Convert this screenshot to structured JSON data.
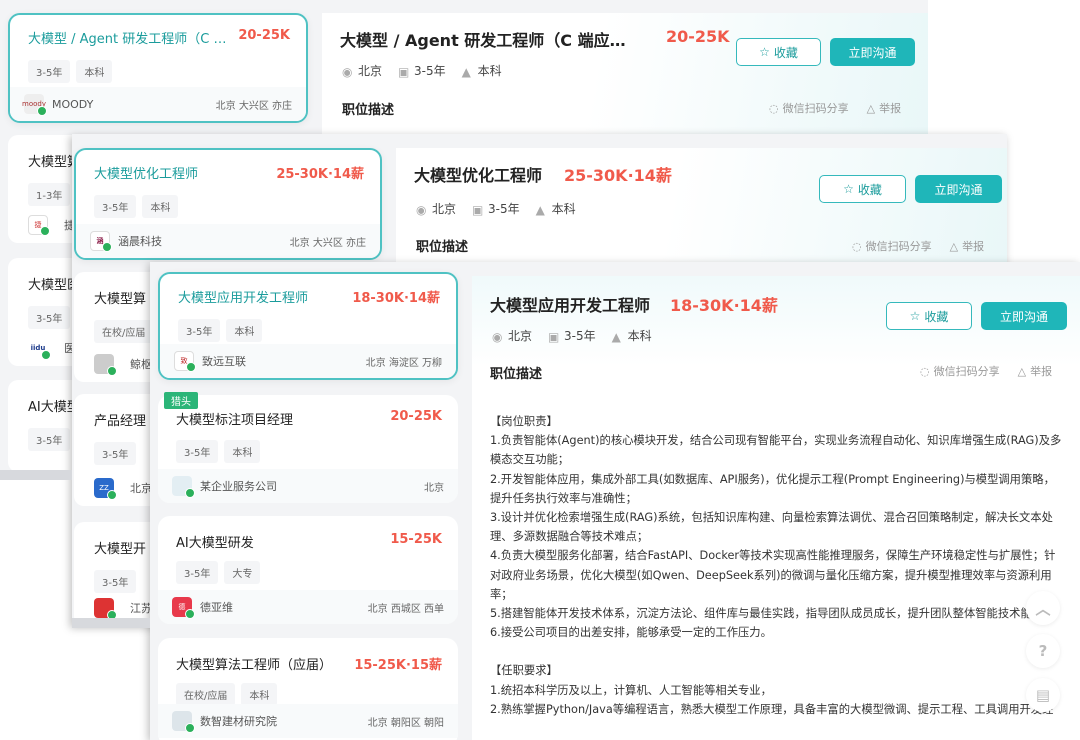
{
  "win1": {
    "card_active": {
      "title": "大模型 / Agent 研发工程师（C 端应用方向）",
      "salary": "20-25K",
      "tags": [
        "3-5年",
        "本科"
      ],
      "company": "MOODY",
      "location": "北京 大兴区 亦庄",
      "logo_text": "moody"
    },
    "frag_cards": [
      {
        "title": "大模型算",
        "tag": "1-3年",
        "company": "捷科",
        "logo_text": "捷"
      },
      {
        "title": "大模型医",
        "tag": "3-5年",
        "company": "医",
        "logo_text": "iidu"
      },
      {
        "title": "AI大模型",
        "tag": "3-5年",
        "company": "",
        "logo_text": ""
      }
    ],
    "detail": {
      "title": "大模型 / Agent 研发工程师（C 端应用方向）",
      "salary": "20-25K",
      "fav_label": "收藏",
      "chat_label": "立即沟通",
      "meta": [
        "北京",
        "3-5年",
        "本科"
      ],
      "section": "职位描述",
      "share": "微信扫码分享",
      "report": "举报"
    }
  },
  "win2": {
    "card_active": {
      "title": "大模型优化工程师",
      "salary": "25-30K·14薪",
      "tags": [
        "3-5年",
        "本科"
      ],
      "company": "涵晨科技",
      "location": "北京 大兴区 亦庄",
      "logo_text": "涵"
    },
    "frag_cards": [
      {
        "title": "大模型算",
        "tag": "在校/应届",
        "company": "鲸枢科",
        "logo_text": ""
      },
      {
        "title": "产品经理",
        "tag": "3-5年",
        "company": "北京深",
        "logo_text": "ZZ"
      },
      {
        "title": "大模型开",
        "tag": "3-5年",
        "company": "江苏",
        "logo_text": ""
      }
    ],
    "detail": {
      "title": "大模型优化工程师",
      "salary": "25-30K·14薪",
      "fav_label": "收藏",
      "chat_label": "立即沟通",
      "meta": [
        "北京",
        "3-5年",
        "本科"
      ],
      "section": "职位描述",
      "share": "微信扫码分享",
      "report": "举报"
    }
  },
  "win3": {
    "cards": [
      {
        "title": "大模型应用开发工程师",
        "salary": "18-30K·14薪",
        "tags": [
          "3-5年",
          "本科"
        ],
        "company": "致远互联",
        "location": "北京 海淀区 万柳",
        "logo_text": "致",
        "active": true
      },
      {
        "title": "大模型标注项目经理",
        "salary": "20-25K",
        "tags": [
          "3-5年",
          "本科"
        ],
        "company": "某企业服务公司",
        "location": "北京",
        "logo_text": "",
        "badge": "猎头"
      },
      {
        "title": "AI大模型研发",
        "salary": "15-25K",
        "tags": [
          "3-5年",
          "大专"
        ],
        "company": "德亚维",
        "location": "北京 西城区 西单",
        "logo_text": "德"
      },
      {
        "title": "大模型算法工程师（应届）",
        "salary": "15-25K·15薪",
        "tags": [
          "在校/应届",
          "本科"
        ],
        "company": "数智建材研究院",
        "location": "北京 朝阳区 朝阳",
        "logo_text": ""
      }
    ],
    "detail": {
      "title": "大模型应用开发工程师",
      "salary": "18-30K·14薪",
      "fav_label": "收藏",
      "chat_label": "立即沟通",
      "meta": [
        "北京",
        "3-5年",
        "本科"
      ],
      "section": "职位描述",
      "share": "微信扫码分享",
      "report": "举报",
      "description": [
        "【岗位职责】",
        "1.负责智能体(Agent)的核心模块开发，结合公司现有智能平台，实现业务流程自动化、知识库增强生成(RAG)及多模态交互功能；",
        "2.开发智能体应用，集成外部工具(如数据库、API服务)，优化提示工程(Prompt Engineering)与模型调用策略，提升任务执行效率与准确性；",
        "3.设计并优化检索增强生成(RAG)系统，包括知识库构建、向量检索算法调优、混合召回策略制定，解决长文本处理、多源数据融合等技术难点；",
        "4.负责大模型服务化部署，结合FastAPI、Docker等技术实现高性能推理服务，保障生产环境稳定性与扩展性；针对政府业务场景，优化大模型(如Qwen、DeepSeek系列)的微调与量化压缩方案，提升模型推理效率与资源利用率；",
        "5.搭建智能体开发技术体系，沉淀方法论、组件库与最佳实践，指导团队成员成长，提升团队整体智能技术能力；",
        "6.接受公司项目的出差安排，能够承受一定的工作压力。",
        "",
        "【任职要求】",
        "1.统招本科学历及以上，计算机、人工智能等相关专业，",
        "2.熟练掌握Python/Java等编程语言，熟悉大模型工作原理，具备丰富的大模型微调、提示工程、工具调用开发经"
      ]
    },
    "side_buttons": [
      "arrow-up-icon",
      "question-icon",
      "note-icon"
    ]
  },
  "colors": {
    "accent": "#1fb6b9",
    "accent_text": "#1b9c9c",
    "salary": "#f05a4b",
    "badge": "#2bb578"
  }
}
